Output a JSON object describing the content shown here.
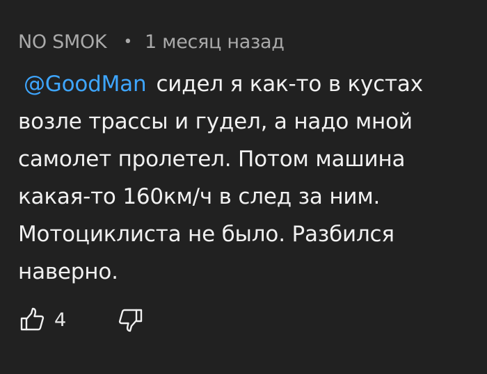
{
  "comment": {
    "author": "NO SMOK",
    "separator": "•",
    "time": "1 месяц назад",
    "mention": "@GoodMan",
    "text": "сидел я как-то в кустах возле трассы и гудел, а надо мной самолет пролетел. Потом машина какая-то 160км/ч в след за ним. Мотоциклиста не было. Разбился наверно."
  },
  "actions": {
    "like_icon": "thumbs-up-icon",
    "like_count": "4",
    "dislike_icon": "thumbs-down-icon"
  },
  "colors": {
    "background": "#212121",
    "text": "#f1f1f1",
    "meta": "#aaaaaa",
    "mention": "#3ea6ff"
  }
}
